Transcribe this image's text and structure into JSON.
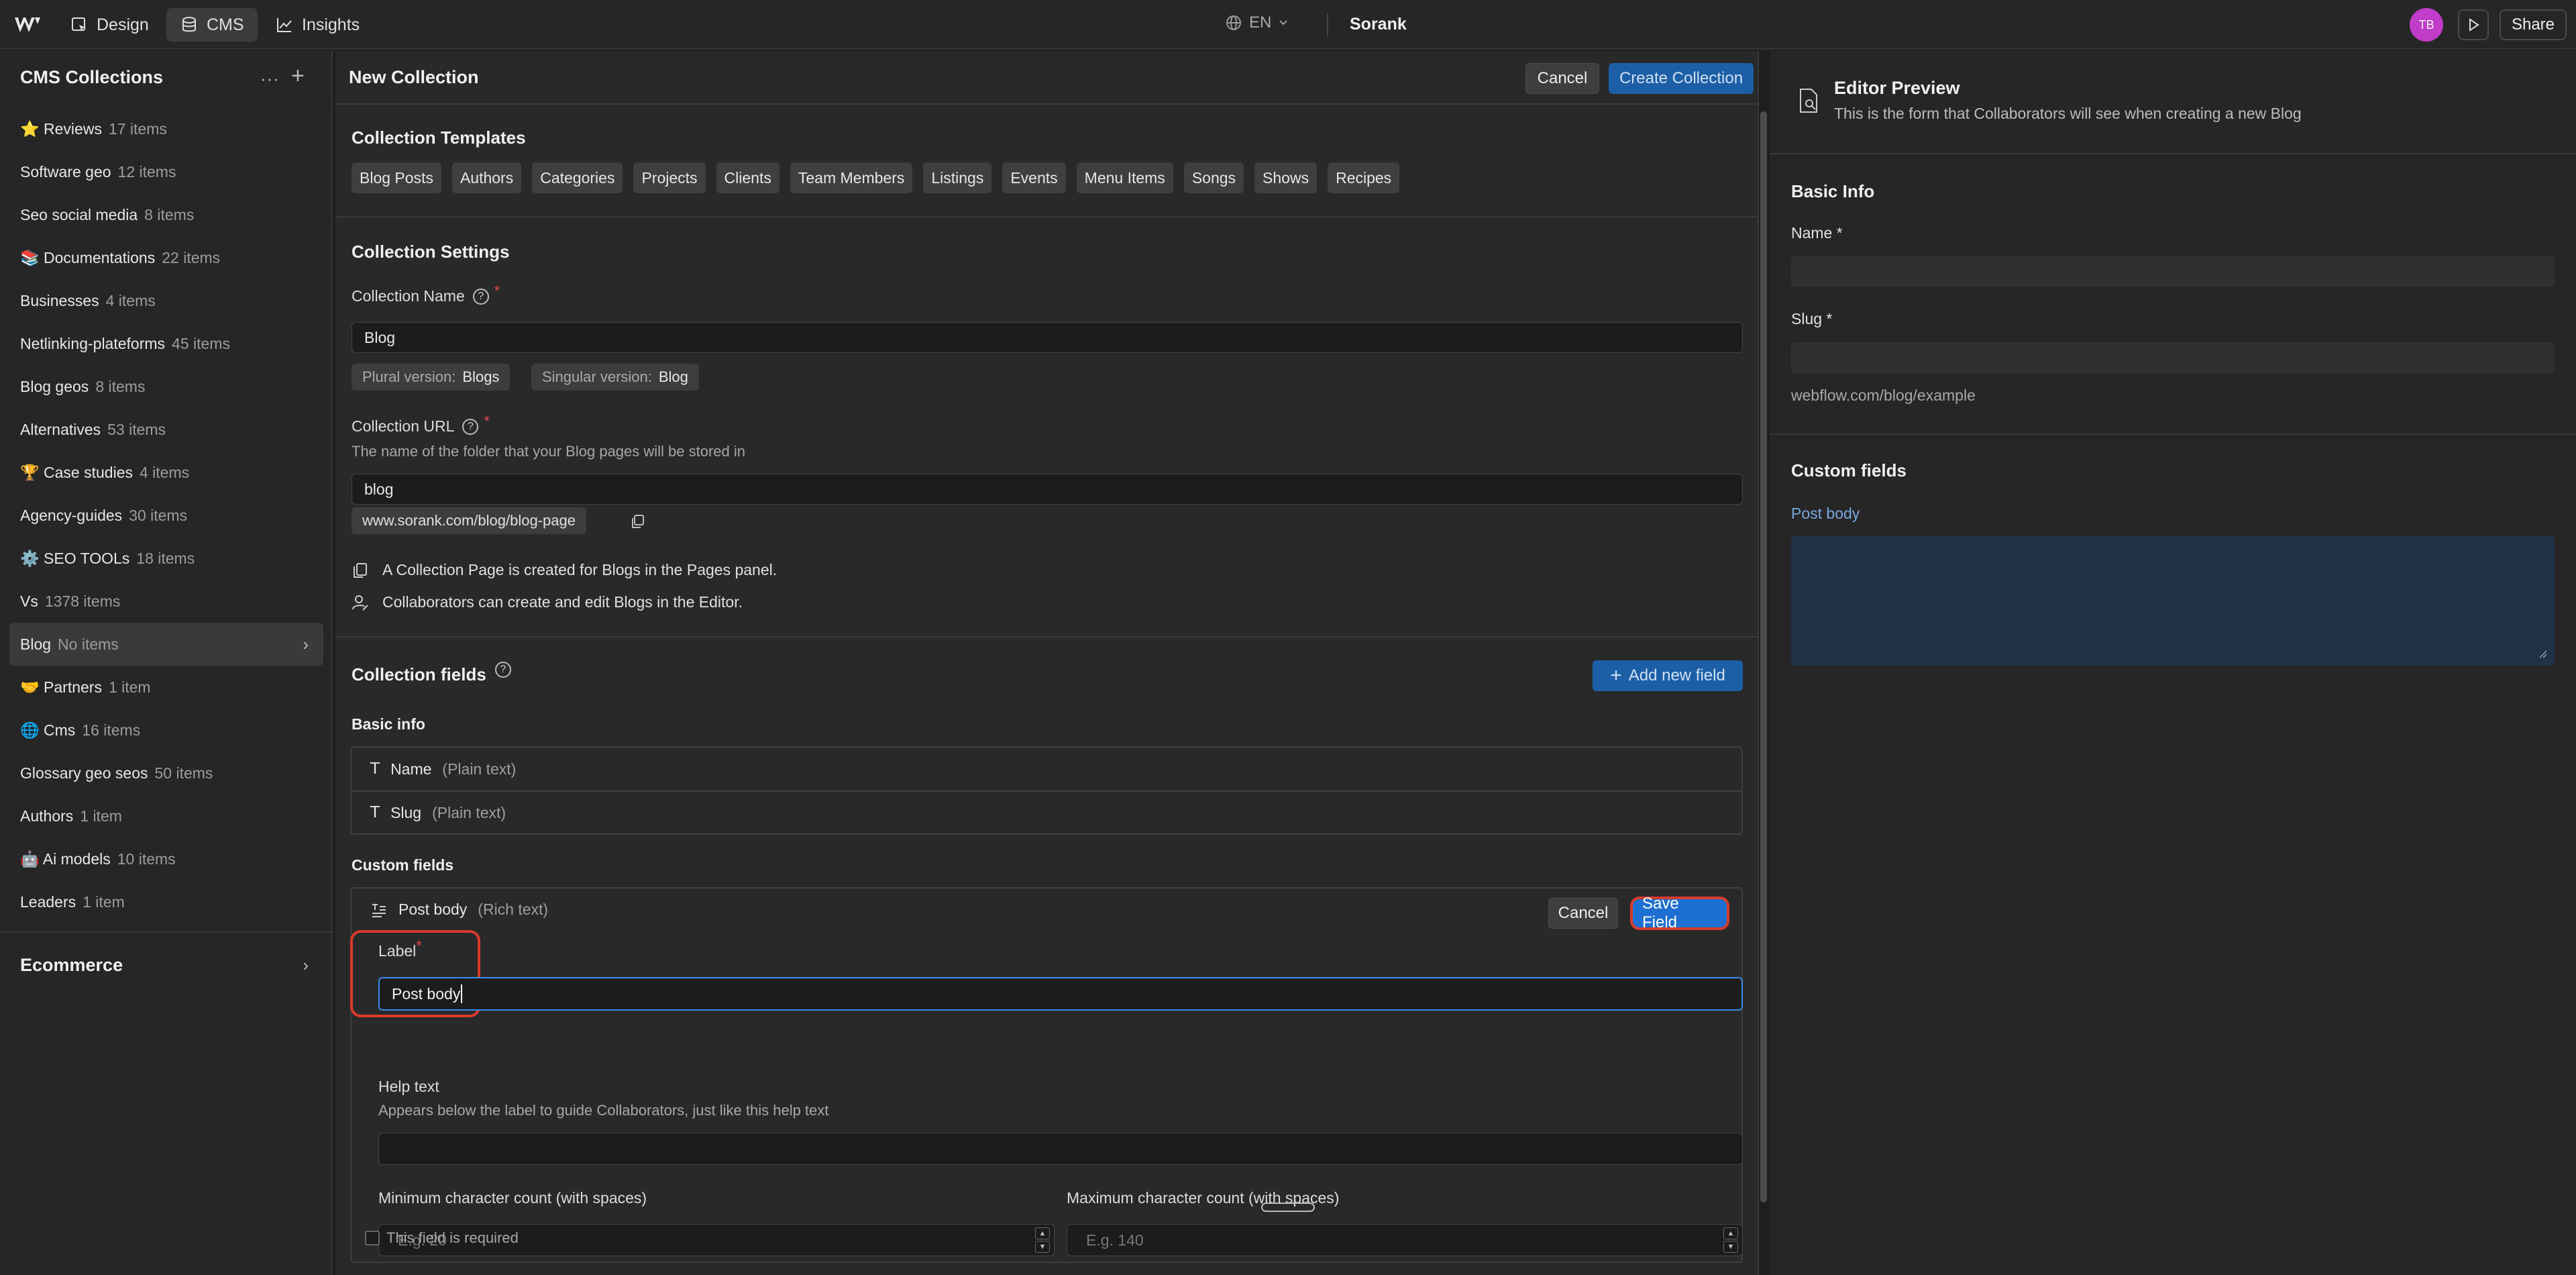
{
  "topbar": {
    "tabs": [
      {
        "label": "Design",
        "icon": "design-icon"
      },
      {
        "label": "CMS",
        "icon": "database-icon"
      },
      {
        "label": "Insights",
        "icon": "chart-icon"
      }
    ],
    "language": "EN",
    "site_name": "Sorank",
    "avatar_initials": "TB",
    "share_label": "Share"
  },
  "sidebar": {
    "title": "CMS Collections",
    "items": [
      {
        "name": "⭐ Reviews",
        "count": "17 items"
      },
      {
        "name": "Software geo",
        "count": "12 items"
      },
      {
        "name": "Seo social media",
        "count": "8 items"
      },
      {
        "name": "📚 Documentations",
        "count": "22 items"
      },
      {
        "name": "Businesses",
        "count": "4 items"
      },
      {
        "name": "Netlinking-plateforms",
        "count": "45 items"
      },
      {
        "name": "Blog geos",
        "count": "8 items"
      },
      {
        "name": "Alternatives",
        "count": "53 items"
      },
      {
        "name": "🏆 Case studies",
        "count": "4 items"
      },
      {
        "name": "Agency-guides",
        "count": "30 items"
      },
      {
        "name": "⚙️ SEO TOOLs",
        "count": "18 items"
      },
      {
        "name": "Vs",
        "count": "1378 items"
      },
      {
        "name": "Blog",
        "count": "No items"
      },
      {
        "name": "🤝 Partners",
        "count": "1 item"
      },
      {
        "name": "🌐 Cms",
        "count": "16 items"
      },
      {
        "name": "Glossary geo seos",
        "count": "50 items"
      },
      {
        "name": "Authors",
        "count": "1 item"
      },
      {
        "name": "🤖 Ai models",
        "count": "10 items"
      },
      {
        "name": "Leaders",
        "count": "1 item"
      }
    ],
    "ecommerce_label": "Ecommerce"
  },
  "main": {
    "title": "New Collection",
    "cancel_label": "Cancel",
    "create_label": "Create Collection",
    "templates_title": "Collection Templates",
    "templates": [
      "Blog Posts",
      "Authors",
      "Categories",
      "Projects",
      "Clients",
      "Team Members",
      "Listings",
      "Events",
      "Menu Items",
      "Songs",
      "Shows",
      "Recipes"
    ],
    "settings_title": "Collection Settings",
    "name_label": "Collection Name",
    "name_value": "Blog",
    "plural_label": "Plural version:",
    "plural_value": "Blogs",
    "singular_label": "Singular version:",
    "singular_value": "Blog",
    "url_label": "Collection URL",
    "url_desc": "The name of the folder that your Blog pages will be stored in",
    "url_value": "blog",
    "url_preview": "www.sorank.com/blog/blog-page",
    "info_page": "A Collection Page is created for Blogs in the Pages panel.",
    "info_editor": "Collaborators can create and edit Blogs in the Editor.",
    "fields_title": "Collection fields",
    "add_field_label": "Add new field",
    "basic_info_title": "Basic info",
    "basic_fields": [
      {
        "name": "Name",
        "type": "(Plain text)"
      },
      {
        "name": "Slug",
        "type": "(Plain text)"
      }
    ],
    "custom_fields_title": "Custom fields",
    "custom_field": {
      "name": "Post body",
      "type": "(Rich text)",
      "cancel_label": "Cancel",
      "save_label": "Save Field",
      "label_label": "Label",
      "label_value": "Post body",
      "help_label": "Help text",
      "help_desc": "Appears below the label to guide Collaborators, just like this help text",
      "min_label": "Minimum character count (with spaces)",
      "min_placeholder": "E.g. 20",
      "max_label": "Maximum character count (with spaces)",
      "max_placeholder": "E.g. 140",
      "required_label": "This field is required"
    }
  },
  "preview": {
    "title": "Editor Preview",
    "subtitle": "This is the form that Collaborators will see when creating a new Blog",
    "basic_title": "Basic Info",
    "name_label": "Name *",
    "slug_label": "Slug *",
    "slug_note": "webflow.com/blog/example",
    "custom_title": "Custom fields",
    "post_body_label": "Post body"
  },
  "colors": {
    "accent_blue": "#1c5fa6",
    "focus_blue": "#3b8bea",
    "highlight_red": "#d93a2b",
    "avatar_pink": "#c13cc8"
  }
}
